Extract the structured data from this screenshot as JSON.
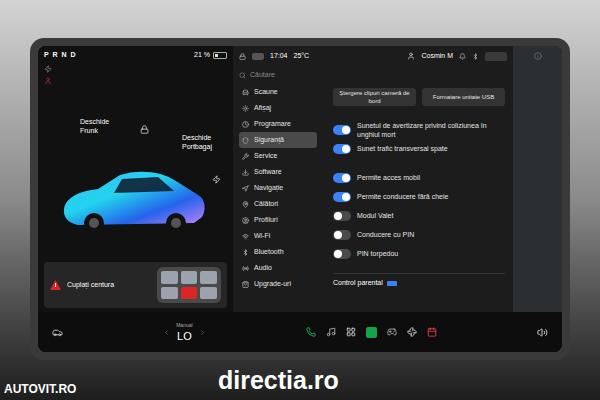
{
  "screen": {
    "gear": "P R N D",
    "battery": "21 %"
  },
  "car": {
    "frunk_label": "Deschide Frunk",
    "trunk_label": "Deschide Portbagaj"
  },
  "alert": {
    "text": "Cuplați centura"
  },
  "status": {
    "time": "17:04",
    "temperature": "25°C",
    "user": "Cosmin M"
  },
  "search": {
    "placeholder": "Căutare"
  },
  "sidebar": {
    "items": [
      {
        "label": "Scaune",
        "selected": false
      },
      {
        "label": "Afișaj",
        "selected": false
      },
      {
        "label": "Programare",
        "selected": false
      },
      {
        "label": "Siguranță",
        "selected": true
      },
      {
        "label": "Service",
        "selected": false
      },
      {
        "label": "Software",
        "selected": false
      },
      {
        "label": "Navigație",
        "selected": false
      },
      {
        "label": "Călători",
        "selected": false
      },
      {
        "label": "Profiluri",
        "selected": false
      },
      {
        "label": "Wi-Fi",
        "selected": false
      },
      {
        "label": "Bluetooth",
        "selected": false
      },
      {
        "label": "Audio",
        "selected": false
      },
      {
        "label": "Upgrade-uri",
        "selected": false
      }
    ]
  },
  "actions": [
    "Ștergere clipuri cameră de bord",
    "Formatare unitate USB"
  ],
  "sound_settings": [
    {
      "label": "Sunetul de avertizare privind coliziunea în unghiul mort",
      "on": true
    },
    {
      "label": "Sunet trafic transversal spate",
      "on": true
    }
  ],
  "access_settings": [
    {
      "label": "Permite acces mobil",
      "on": true
    },
    {
      "label": "Permite conducere fără cheie",
      "on": true
    },
    {
      "label": "Modul Valet",
      "on": false
    },
    {
      "label": "Conducere cu PIN",
      "on": false
    },
    {
      "label": "PIN torpedou",
      "on": false
    }
  ],
  "section": {
    "title": "Control parental"
  },
  "climate": {
    "mode": "Manual",
    "temperature": "LO"
  },
  "watermarks": [
    "AUTOVIT.RO",
    "directia.ro"
  ]
}
